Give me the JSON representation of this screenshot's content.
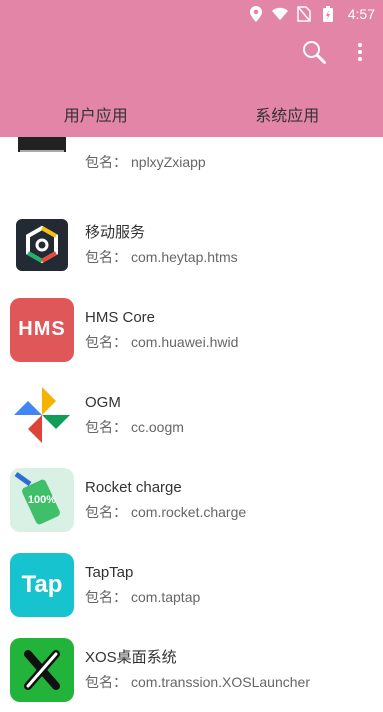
{
  "status": {
    "time": "4:57"
  },
  "tabs": [
    {
      "label": "用户应用"
    },
    {
      "label": "系统应用"
    }
  ],
  "apps": [
    {
      "name": "",
      "pkg_label": "包名：",
      "pkg": "nplxyZxiapp"
    },
    {
      "name": "移动服务",
      "pkg_label": "包名：",
      "pkg": "com.heytap.htms"
    },
    {
      "name": "HMS Core",
      "pkg_label": "包名：",
      "pkg": "com.huawei.hwid"
    },
    {
      "name": "OGM",
      "pkg_label": "包名：",
      "pkg": "cc.oogm"
    },
    {
      "name": "Rocket charge",
      "pkg_label": "包名：",
      "pkg": "com.rocket.charge"
    },
    {
      "name": "TapTap",
      "pkg_label": "包名：",
      "pkg": "com.taptap"
    },
    {
      "name": "XOS桌面系统",
      "pkg_label": "包名：",
      "pkg": "com.transsion.XOSLauncher"
    }
  ],
  "icons": {
    "app0": "partial-app-icon",
    "app1": "heytap-service-icon",
    "app2": "hms-core-icon",
    "app3": "pinwheel-icon",
    "app4": "rocket-charge-icon",
    "app5": "taptap-icon",
    "app6": "xos-launcher-icon",
    "hms_text": "HMS",
    "rocket_text": "100%",
    "taptap_text": "Tap"
  },
  "colors": {
    "appbar": "#e385a6",
    "hms": "#e0575a",
    "taptap": "#18c3d0",
    "xos": "#22b33a"
  }
}
